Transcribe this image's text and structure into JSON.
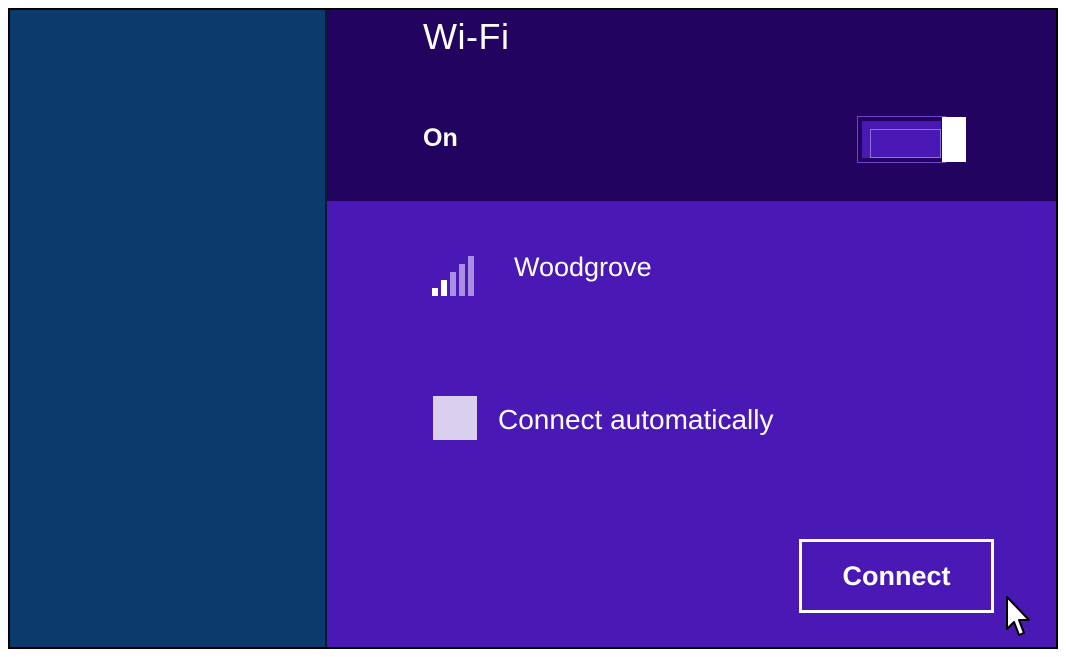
{
  "wifi": {
    "title": "Wi-Fi",
    "toggle_label": "On",
    "toggle_state": "on"
  },
  "network": {
    "name": "Woodgrove",
    "icon": "wifi-signal-icon",
    "signal_bars_total": 5,
    "signal_bars_active": 2
  },
  "auto_connect": {
    "label": "Connect automatically",
    "checked": false
  },
  "actions": {
    "connect_label": "Connect"
  },
  "colors": {
    "left_pane": "#0b3a6c",
    "header": "#22035f",
    "panel": "#4a18b4",
    "text": "#ffffff",
    "checkbox": "#d8d0ee"
  }
}
